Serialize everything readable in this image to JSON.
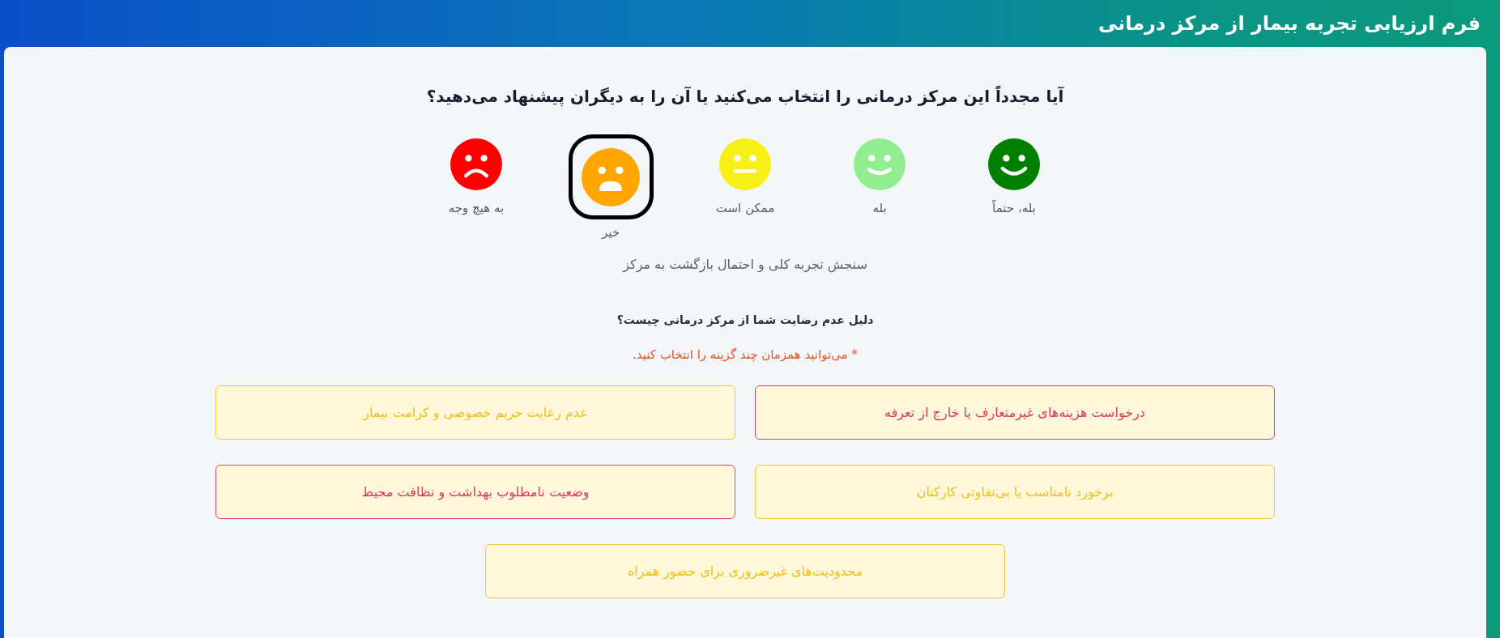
{
  "header": {
    "title": "فرم ارزیابی تجربه بیمار از مرکز درمانی"
  },
  "question": {
    "title": "آیا مجدداً این مرکز درمانی را انتخاب می‌کنید یا آن را به دیگران پیشنهاد می‌دهید؟",
    "ratings": [
      {
        "label": "بله، حتماً",
        "kind": "grin",
        "color": "#008000",
        "selected": false
      },
      {
        "label": "بله",
        "kind": "smile",
        "color": "#90ee90",
        "selected": false
      },
      {
        "label": "ممکن است",
        "kind": "neutral",
        "color": "#f7ef16",
        "selected": false
      },
      {
        "label": "خیر",
        "kind": "sad",
        "color": "#ffa500",
        "selected": true
      },
      {
        "label": "به هیچ وجه",
        "kind": "frown",
        "color": "#ff0000",
        "selected": false
      }
    ],
    "caption": "سنجش تجربه کلی و احتمال بازگشت به مرکز"
  },
  "reasons": {
    "title": "دلیل عدم رضایت شما از مرکز درمانی چیست؟",
    "note": "* می‌توانید همزمان چند گزینه را انتخاب کنید.",
    "options": [
      {
        "label": "درخواست هزینه‌های غیرمتعارف یا خارج از تعرفه",
        "selected": true
      },
      {
        "label": "عدم رعایت حریم خصوصی و کرامت بیمار",
        "selected": false
      },
      {
        "label": "برخورد نامناسب یا بی‌تفاوتی کارکنان",
        "selected": false
      },
      {
        "label": "وضعیت نامطلوب بهداشت و نظافت محیط",
        "selected": true
      },
      {
        "label": "محدودیت‌های غیرضروری برای حضور همراه",
        "selected": false
      }
    ]
  }
}
